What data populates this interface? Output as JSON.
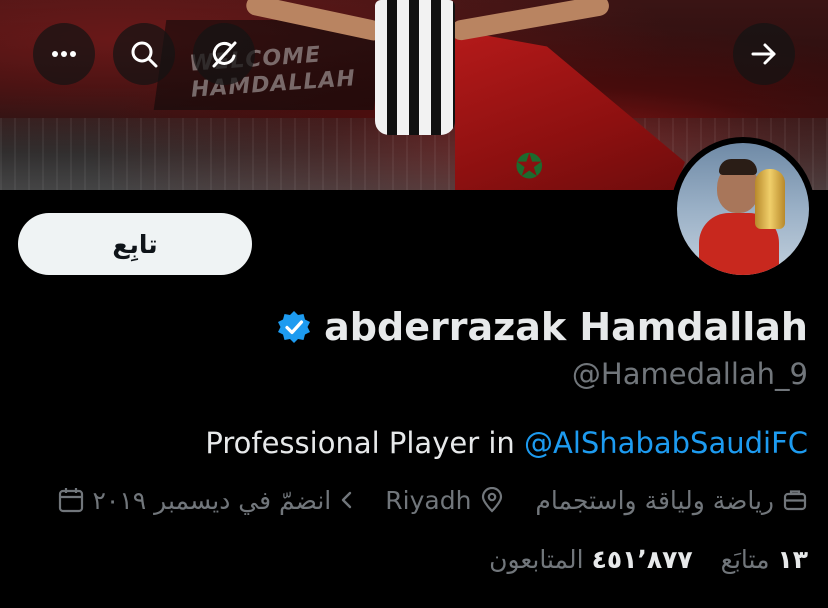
{
  "header": {
    "buttons": {
      "more_icon": "more-icon",
      "search_icon": "search-icon",
      "grok_icon": "grok-icon",
      "forward_icon": "arrow-right-icon"
    }
  },
  "banner": {
    "sign_line1": "WELCOME",
    "sign_line2": "HAMDALLAH"
  },
  "profile": {
    "follow_label": "تابِع",
    "display_name": "abderrazak Hamdallah",
    "verified_icon": "verified-badge-icon",
    "handle": "@Hamedallah_9",
    "bio_prefix": "Professional Player in ",
    "bio_mention": "@AlShababSaudiFC",
    "meta": {
      "category": "رياضة ولياقة واستجمام",
      "location": "Riyadh",
      "joined": "انضمّ في ديسمبر ٢٠١٩"
    },
    "stats": {
      "following_count": "١٣",
      "following_label": "متابَع",
      "followers_count": "٤٥١٬٨٧٧",
      "followers_label": "المتابعون"
    }
  },
  "colors": {
    "accent": "#1d9bf0",
    "muted": "#71767b",
    "background": "#000000"
  }
}
